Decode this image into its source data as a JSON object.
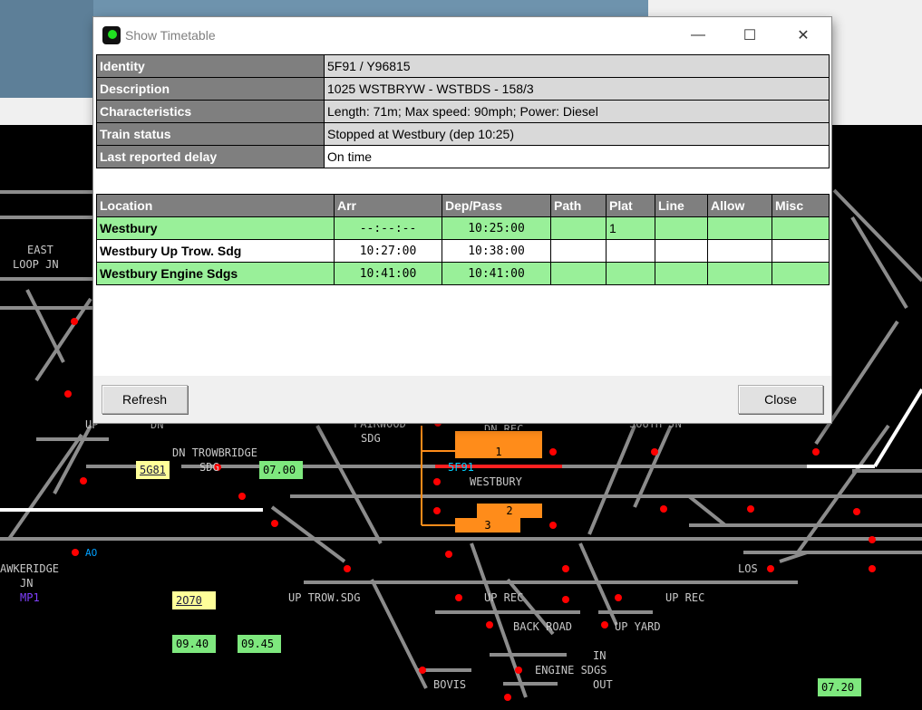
{
  "dialog": {
    "title": "Show Timetable",
    "window_buttons": {
      "minimize": "—",
      "maximize": "☐",
      "close": "✕"
    },
    "info": [
      {
        "key": "Identity",
        "value": "5F91 / Y96815"
      },
      {
        "key": "Description",
        "value": "1025 WSTBRYW - WSTBDS - 158/3"
      },
      {
        "key": "Characteristics",
        "value": "Length: 71m; Max speed: 90mph; Power: Diesel"
      },
      {
        "key": "Train status",
        "value": "Stopped at Westbury (dep 10:25)"
      },
      {
        "key": "Last reported delay",
        "value": "On time"
      }
    ],
    "timetable": {
      "headers": [
        "Location",
        "Arr",
        "Dep/Pass",
        "Path",
        "Plat",
        "Line",
        "Allow",
        "Misc"
      ],
      "rows": [
        {
          "location": "Westbury",
          "arr": "--:--:--",
          "dep": "10:25:00",
          "path": "",
          "plat": "1",
          "line": "",
          "allow": "",
          "misc": ""
        },
        {
          "location": "Westbury Up Trow. Sdg",
          "arr": "10:27:00",
          "dep": "10:38:00",
          "path": "",
          "plat": "",
          "line": "",
          "allow": "",
          "misc": ""
        },
        {
          "location": "Westbury Engine Sdgs",
          "arr": "10:41:00",
          "dep": "10:41:00",
          "path": "",
          "plat": "",
          "line": "",
          "allow": "",
          "misc": ""
        }
      ]
    },
    "buttons": {
      "refresh": "Refresh",
      "close": "Close"
    }
  },
  "map": {
    "labels": {
      "east_loop_1": "EAST",
      "east_loop_2": "LOOP JN",
      "up_left": "UP",
      "dn_left": "DN",
      "dn_trowbridge_1": "DN TROWBRIDGE",
      "dn_trowbridge_2": "SDG",
      "fairwood_1": "FAIRWOOD",
      "fairwood_2": "SDG",
      "dn_rec": "DN REC",
      "south_jn": "SOUTH JN",
      "westbury": "WESTBURY",
      "hawkeridge_1": "AWKERIDGE",
      "hawkeridge_2": "JN",
      "mp1": "MP1",
      "ao": "AO",
      "up_trow_sdg": "UP TROW.SDG",
      "up_rec_1": "UP REC",
      "up_rec_2": "UP REC",
      "back_road": "BACK ROAD",
      "up_yard": "UP YARD",
      "los": "LOS",
      "in": "IN",
      "engine_sdgs": "ENGINE SDGS",
      "out": "OUT",
      "bovis": "BOVIS"
    },
    "platforms": {
      "p1": "1",
      "p2": "2",
      "p3": "3"
    },
    "train_id": "5F91",
    "describers": {
      "d1": "5G81",
      "d2": "2O70",
      "t1": "07.00",
      "t2": "09.40",
      "t3": "09.45",
      "t4": "07.20"
    },
    "colors": {
      "track": "#8c8c8c",
      "route_set": "#ffffff",
      "occupied": "#ff2020",
      "platform": "#ff8c1a",
      "signal_red": "#ff0000",
      "train_id": "#00c0ff",
      "mp_label": "#8040ff"
    }
  }
}
